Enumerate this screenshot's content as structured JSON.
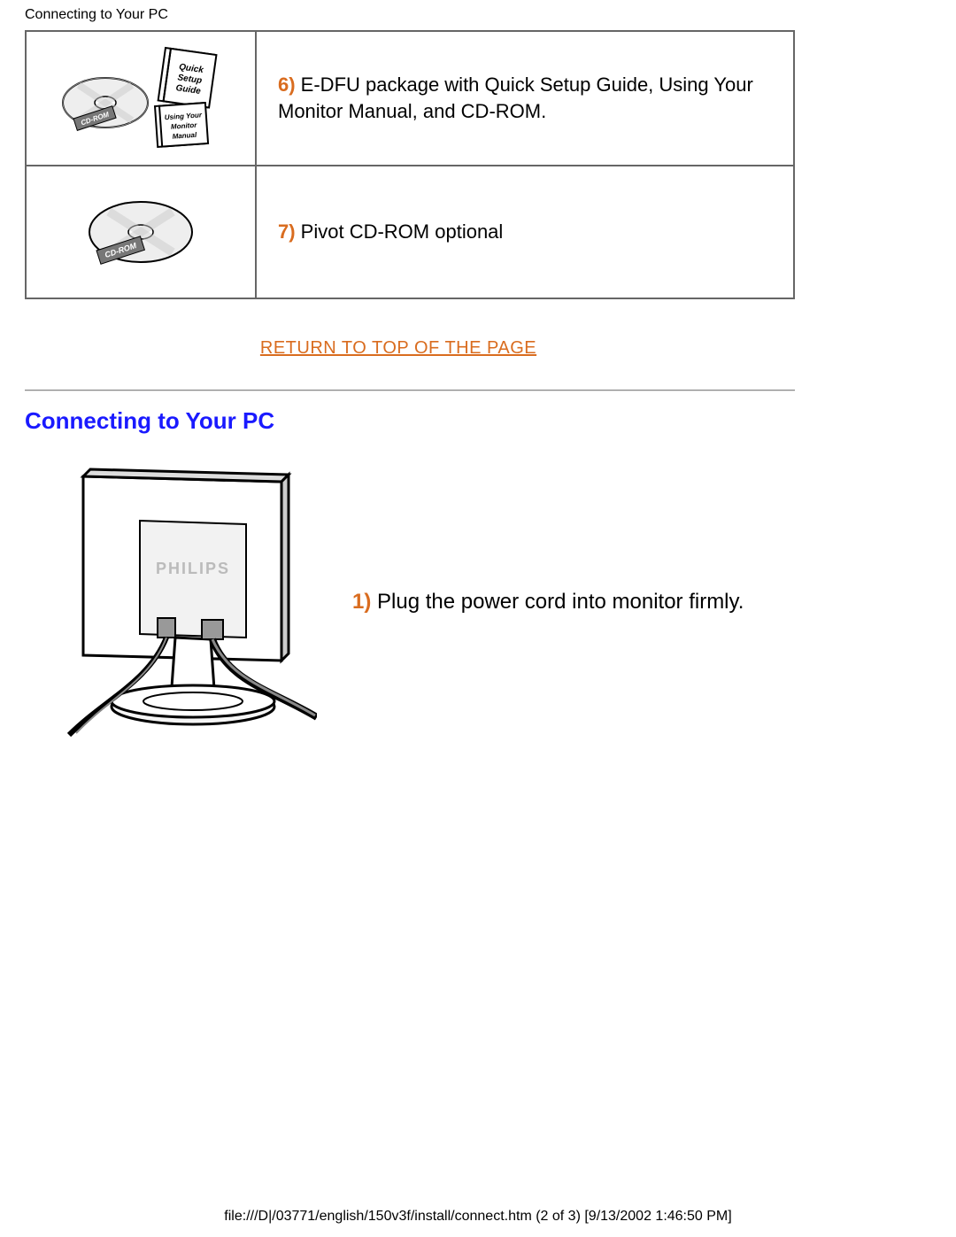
{
  "header_label": "Connecting to Your PC",
  "items": [
    {
      "num": "6)",
      "text": " E-DFU package with Quick Setup Guide, Using Your Monitor Manual, and CD-ROM."
    },
    {
      "num": "7)",
      "text": " Pivot CD-ROM optional"
    }
  ],
  "return_link": "RETURN TO TOP OF THE PAGE",
  "section_heading": "Connecting to Your PC",
  "step": {
    "num": "1)",
    "text": " Plug the power cord into monitor firmly."
  },
  "cd_label": "CD-ROM",
  "guide_label_1": "Quick",
  "guide_label_2": "Setup",
  "guide_label_3": "Guide",
  "manual_label_1": "Using Your",
  "manual_label_2": "Monitor",
  "manual_label_3": "Manual",
  "brand": "PHILIPS",
  "footer": "file:///D|/03771/english/150v3f/install/connect.htm (2 of 3) [9/13/2002 1:46:50 PM]"
}
